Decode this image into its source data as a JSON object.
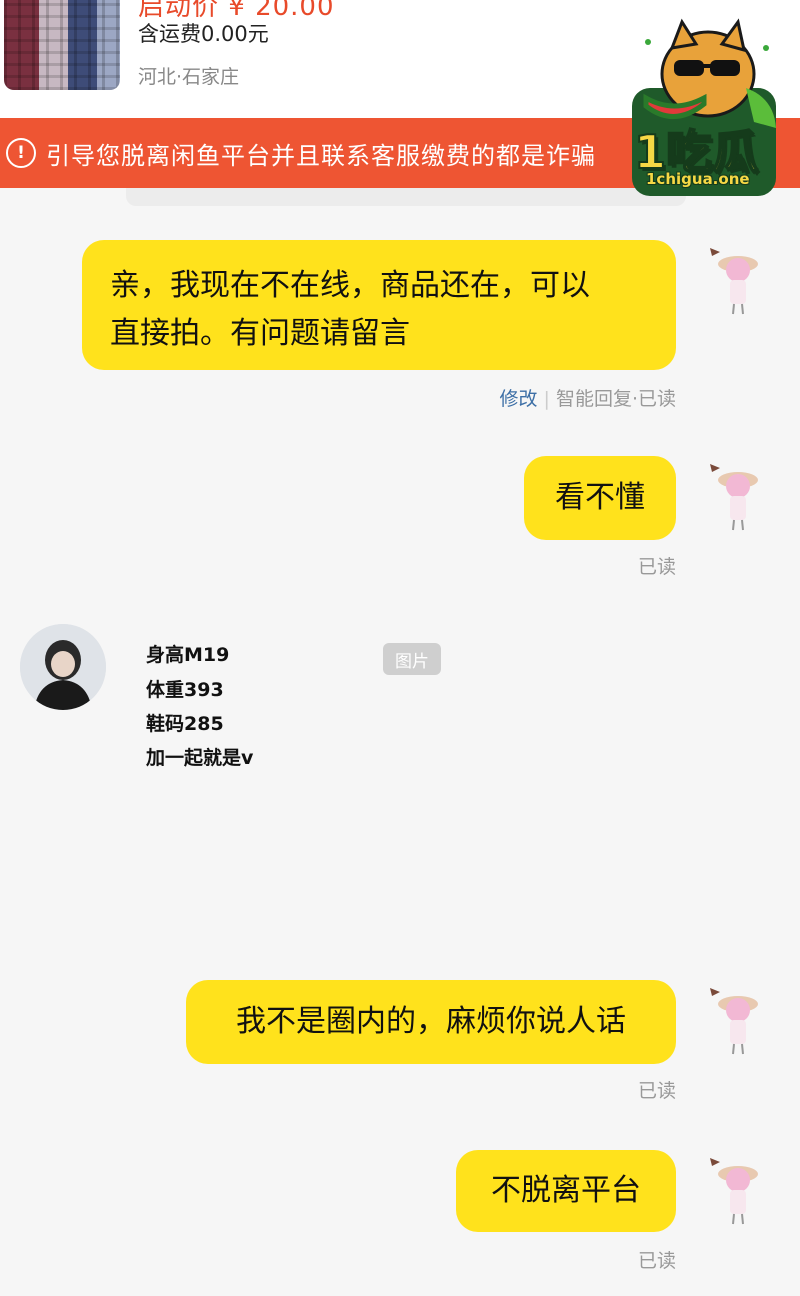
{
  "product": {
    "price_partial": "启动价 ¥ 20.00",
    "shipping": "含运费0.00元",
    "location": "河北·石家庄"
  },
  "warning": {
    "icon": "exclamation-circle-icon",
    "text": "引导您脱离闲鱼平台并且联系客服缴费的都是诈骗"
  },
  "watermark": {
    "logo_text": "1吃瓜",
    "url": "1chigua.one"
  },
  "messages": [
    {
      "lines": [
        "亲，我现在不在线，商品还在，可以",
        "直接拍。有问题请留言"
      ],
      "edit_label": "修改",
      "meta": "智能回复·已读"
    },
    {
      "text": "看不懂",
      "meta": "已读"
    },
    {
      "profile_lines": [
        "身高M19",
        "体重393",
        "鞋码285",
        "加一起就是v"
      ],
      "image_label": "图片"
    },
    {
      "text": "我不是圈内的，麻烦你说人话",
      "meta": "已读"
    },
    {
      "text": "不脱离平台",
      "meta": "已读"
    }
  ],
  "colors": {
    "bubble": "#ffe21c",
    "warning": "#ee5533",
    "edit_link": "#3d6fa6"
  }
}
